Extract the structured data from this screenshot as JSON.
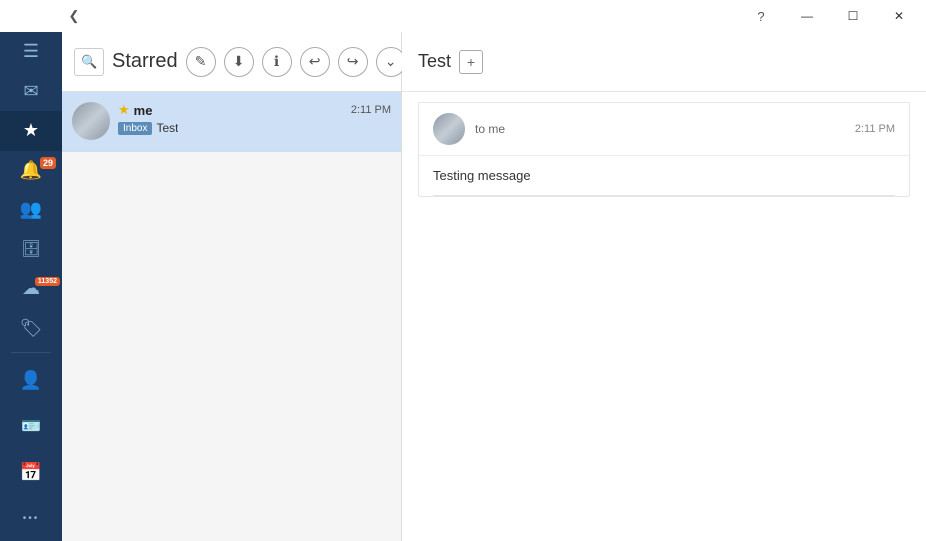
{
  "titlebar": {
    "back_label": "❮",
    "help_label": "?",
    "minimize_label": "—",
    "maximize_label": "☐",
    "close_label": "✕"
  },
  "sidebar": {
    "items": [
      {
        "id": "hamburger",
        "icon": "☰",
        "label": "menu"
      },
      {
        "id": "inbox",
        "icon": "✉",
        "label": "inbox"
      },
      {
        "id": "starred",
        "icon": "★",
        "label": "starred",
        "active": true
      },
      {
        "id": "notifications",
        "icon": "🔔",
        "label": "notifications",
        "badge": "29"
      },
      {
        "id": "contacts",
        "icon": "👥",
        "label": "contacts"
      },
      {
        "id": "work",
        "icon": "💼",
        "label": "work"
      },
      {
        "id": "cloud",
        "icon": "☁",
        "label": "cloud",
        "badge": "11352"
      },
      {
        "id": "tags",
        "icon": "🏷",
        "label": "tags"
      }
    ],
    "bottom_items": [
      {
        "id": "person",
        "icon": "👤",
        "label": "person"
      },
      {
        "id": "contact-card",
        "icon": "📋",
        "label": "contact-card"
      },
      {
        "id": "calendar",
        "icon": "📅",
        "label": "calendar"
      },
      {
        "id": "more",
        "icon": "•••",
        "label": "more"
      }
    ]
  },
  "toolbar": {
    "title": "Starred",
    "search_placeholder": "Search",
    "btn_edit": "✎",
    "btn_download": "⬇",
    "btn_info": "ℹ",
    "btn_prev": "↩",
    "btn_next": "↪",
    "btn_more": "⌄"
  },
  "email_list": {
    "items": [
      {
        "sender": "me",
        "time": "2:11 PM",
        "tag": "Inbox",
        "subject": "Test",
        "starred": true
      }
    ]
  },
  "right_panel": {
    "thread_title": "Test",
    "add_tab_icon": "+",
    "message": {
      "to": "to me",
      "time": "2:11 PM",
      "body": "Testing message"
    }
  }
}
